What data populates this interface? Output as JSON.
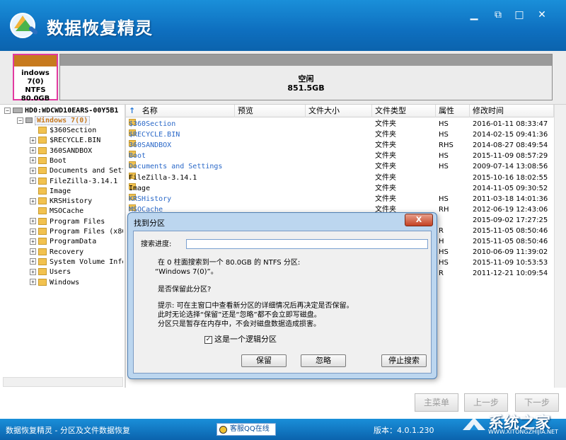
{
  "window": {
    "title": "数据恢复精灵",
    "minimize": "▁",
    "maximize": "□",
    "close": "✕"
  },
  "partition_map": {
    "p1": {
      "line1": "indows 7(0)",
      "line2": "NTFS",
      "line3": "80.0GB"
    },
    "p2": {
      "line1": "空闲",
      "line2": "851.5GB"
    }
  },
  "tree": {
    "disk": "HD0:WDCWD10EARS-00Y5B1",
    "partition": "Windows 7(0)",
    "folders": [
      "$360Section",
      "$RECYCLE.BIN",
      "360SANDBOX",
      "Boot",
      "Documents and Setti",
      "FileZilla-3.14.1",
      "Image",
      "KRSHistory",
      "MSOCache",
      "Program Files",
      "Program Files (x86)",
      "ProgramData",
      "Recovery",
      "System Volume Infor",
      "Users",
      "Windows"
    ]
  },
  "filelist": {
    "columns": [
      "名称",
      "预览",
      "文件大小",
      "文件类型",
      "属性",
      "修改时间"
    ],
    "rows": [
      {
        "name": "$360Section",
        "type": "文件夹",
        "attr": "HS",
        "time": "2016-01-11 08:33:47"
      },
      {
        "name": "$RECYCLE.BIN",
        "type": "文件夹",
        "attr": "HS",
        "time": "2014-02-15 09:41:36"
      },
      {
        "name": "360SANDBOX",
        "type": "文件夹",
        "attr": "RHS",
        "time": "2014-08-27 08:49:54"
      },
      {
        "name": "Boot",
        "type": "文件夹",
        "attr": "HS",
        "time": "2015-11-09 08:57:29"
      },
      {
        "name": "Documents and Settings",
        "type": "文件夹",
        "attr": "HS",
        "time": "2009-07-14 13:08:56"
      },
      {
        "name": "FileZilla-3.14.1",
        "type": "文件夹",
        "attr": "",
        "time": "2015-10-16 18:02:55"
      },
      {
        "name": "Image",
        "type": "文件夹",
        "attr": "",
        "time": "2014-11-05 09:30:52"
      },
      {
        "name": "KRSHistory",
        "type": "文件夹",
        "attr": "HS",
        "time": "2011-03-18 14:01:36"
      },
      {
        "name": "MSOCache",
        "type": "文件夹",
        "attr": "RH",
        "time": "2012-06-19 12:43:06"
      },
      {
        "name": "",
        "type": "",
        "attr": "",
        "time": "2015-09-02 17:27:25"
      },
      {
        "name": "",
        "type": "",
        "attr": "R",
        "time": "2015-11-05 08:50:46"
      },
      {
        "name": "",
        "type": "",
        "attr": "H",
        "time": "2015-11-05 08:50:46"
      },
      {
        "name": "",
        "type": "",
        "attr": "HS",
        "time": "2010-06-09 11:39:02"
      },
      {
        "name": "",
        "type": "",
        "attr": "HS",
        "time": "2015-11-09 10:53:53"
      },
      {
        "name": "",
        "type": "",
        "attr": "R",
        "time": "2011-12-21 10:09:54"
      }
    ]
  },
  "nav": {
    "main_menu": "主菜单",
    "prev": "上一步",
    "next": "下一步"
  },
  "status": {
    "left": "数据恢复精灵 - 分区及文件数据恢复",
    "qq": "客服QQ在线",
    "version": "版本：4.0.1.230"
  },
  "watermark": {
    "text": "系统之家",
    "sub": "WWW.XITONGZHIJIA.NET"
  },
  "dialog": {
    "title": "找到分区",
    "close": "X",
    "progress_label": "搜索进度:",
    "progress_value": 0,
    "msg1": "在 0 柱面搜索到一个 80.0GB 的 NTFS 分区:",
    "msg2": "“Windows 7(0)”。",
    "question": "是否保留此分区?",
    "hint1": "提示: 可在主窗口中查看新分区的详细情况后再决定是否保留。",
    "hint2": "此时无论选择“保留”还是“忽略”都不会立即写磁盘。",
    "hint3": "分区只是暂存在内存中，不会对磁盘数据造成损害。",
    "checkbox_label": "这是一个逻辑分区",
    "checkbox_checked": true,
    "btn_keep": "保留",
    "btn_ignore": "忽略",
    "btn_stop": "停止搜索"
  }
}
